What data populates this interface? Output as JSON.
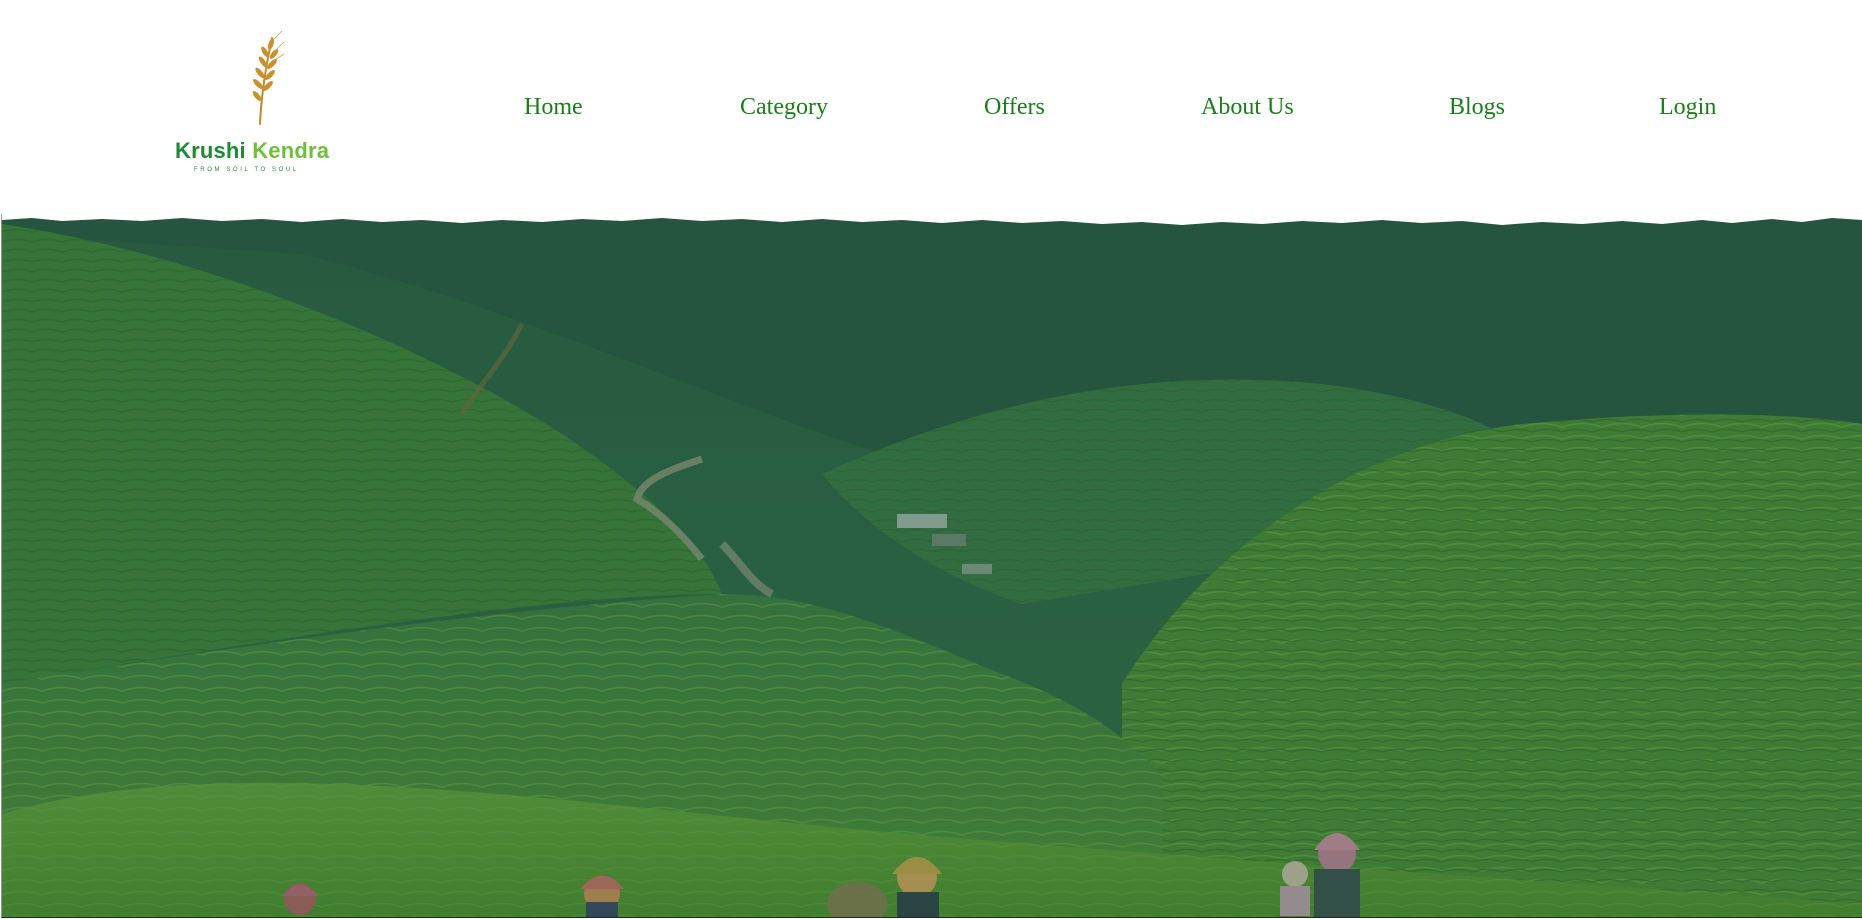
{
  "brand": {
    "name_part1": "Krushi",
    "name_part2": "Kendra",
    "tagline": "FROM SOIL TO SOUL",
    "logo_icon": "wheat-icon",
    "colors": {
      "primary": "#1f8a36",
      "secondary": "#6fbf3b",
      "wheat": "#c28a2a"
    }
  },
  "nav": {
    "items": [
      {
        "label": "Home"
      },
      {
        "label": "Category"
      },
      {
        "label": "Offers"
      },
      {
        "label": "About Us"
      },
      {
        "label": "Blogs"
      },
      {
        "label": "Login"
      }
    ],
    "color": "#1c7d1c"
  },
  "hero": {
    "image": "terraced-rice-fields-photo",
    "overlay_color": "#1f5a3a"
  }
}
